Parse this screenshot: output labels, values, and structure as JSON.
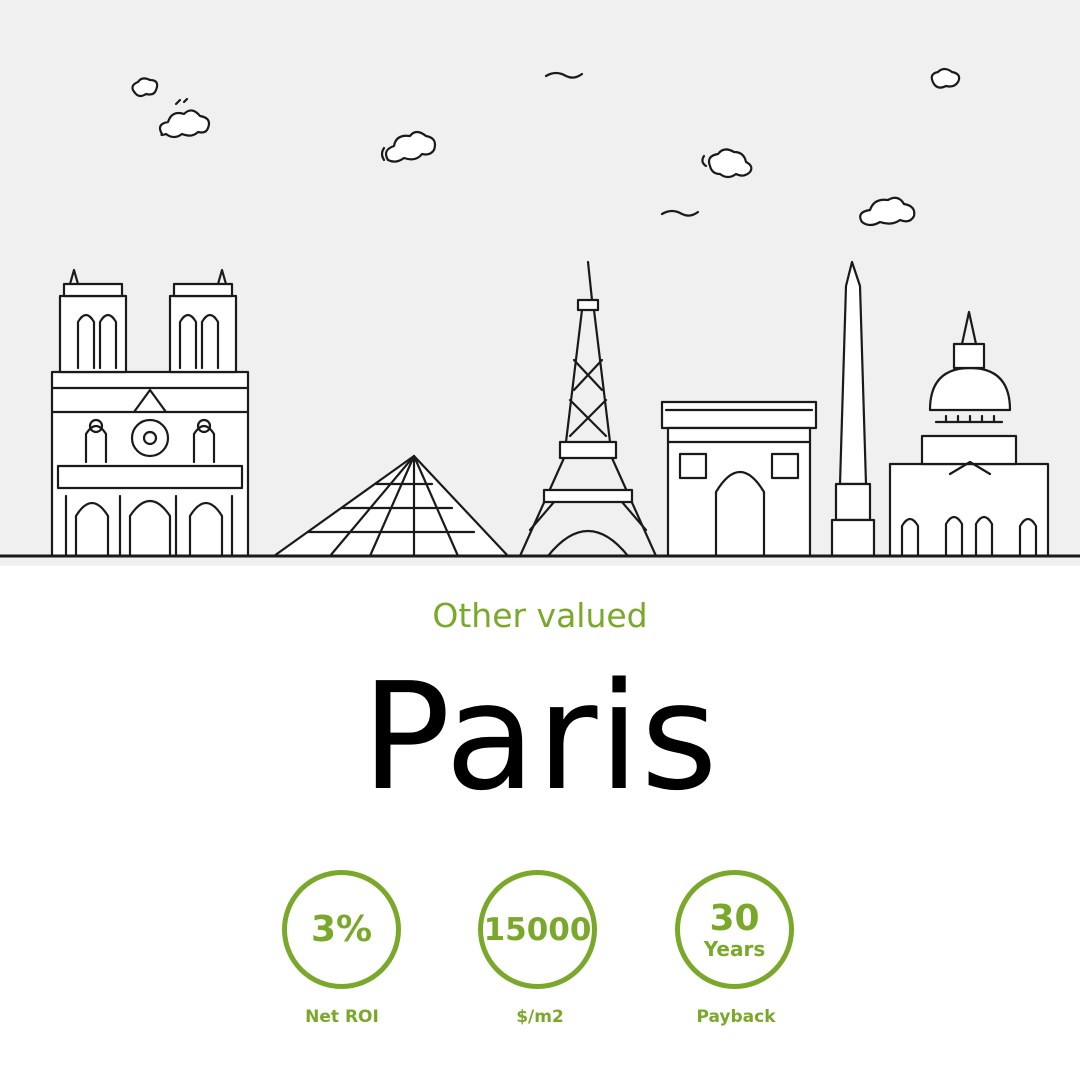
{
  "headline": {
    "subtitle": "Other valued",
    "city": "Paris"
  },
  "stats": [
    {
      "value": "3%",
      "unit": "",
      "label": "Net ROI"
    },
    {
      "value": "15000",
      "unit": "",
      "label": "$/m2"
    },
    {
      "value": "30",
      "unit": "Years",
      "label": "Payback"
    }
  ],
  "colors": {
    "accent": "#7aa82a",
    "sky": "#f0f0f0",
    "line": "#1a1a1a",
    "text": "#000000"
  }
}
